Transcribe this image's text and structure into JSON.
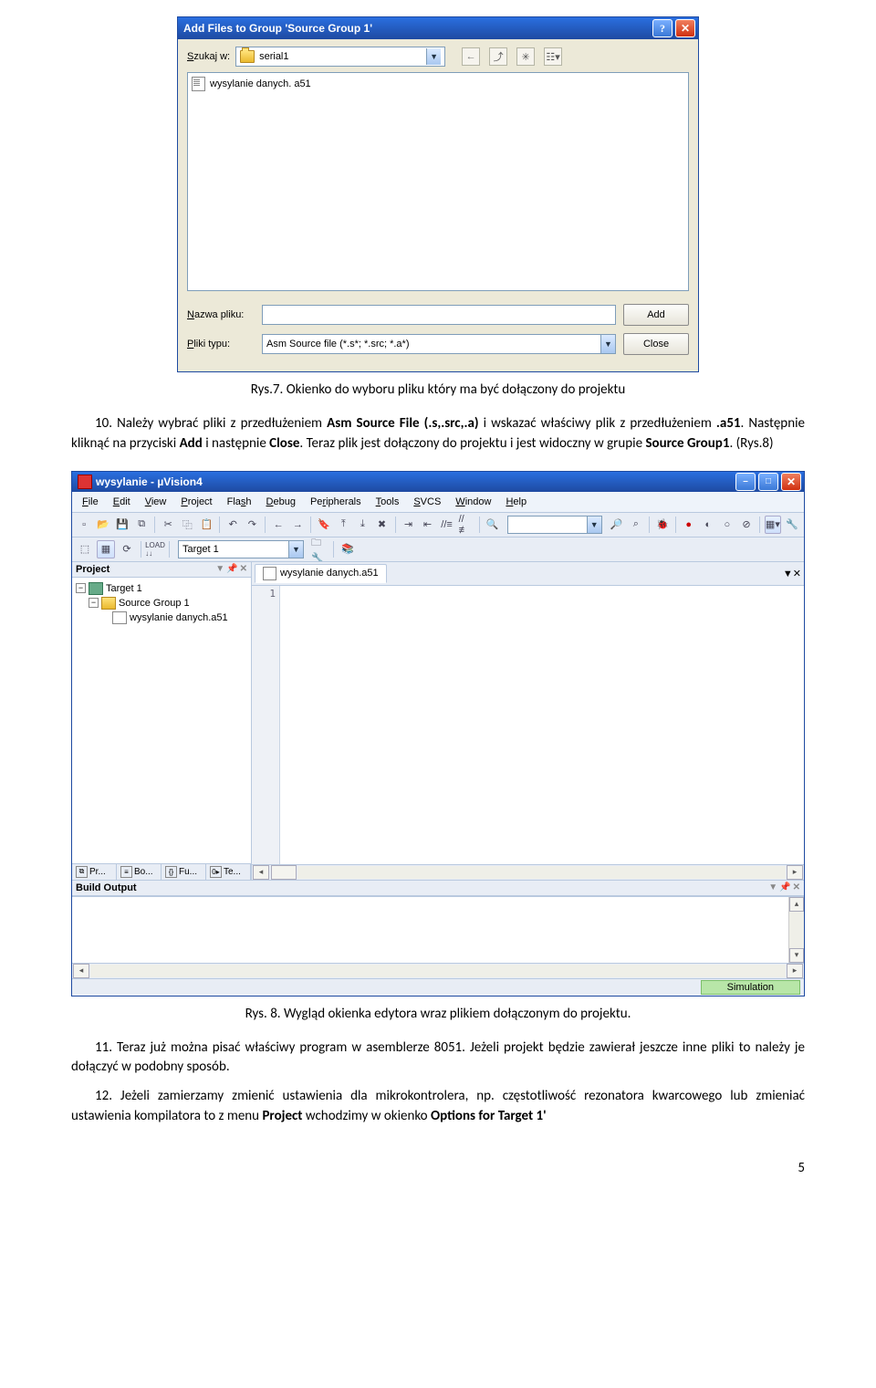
{
  "addFiles": {
    "title": "Add Files to Group 'Source Group 1'",
    "searchLabelPre": "S",
    "searchLabel": "zukaj w:",
    "folderName": "serial1",
    "fileItem": "wysylanie danych. a51",
    "filenameLabelPre": "N",
    "filenameLabel": "azwa pliku:",
    "filenameValue": "",
    "filetypeLabelPre": "P",
    "filetypeLabel": "liki typu:",
    "filetypeValue": "Asm Source file (*.s*; *.src; *.a*)",
    "addBtn": "Add",
    "closeBtn": "Close"
  },
  "caption1": "Rys.7. Okienko do wyboru pliku który ma być dołączony do projektu",
  "para10_pre": "10.",
  "para10": " Należy wybrać pliki z przedłużeniem ",
  "para10_b1": "Asm Source File (.s,.src,.a)",
  "para10_mid": " i wskazać właściwy plik z przedłużeniem ",
  "para10_b2": ".a51",
  "para10_mid2": ". Następnie kliknąć na przyciski ",
  "para10_b3": "Add",
  "para10_mid3": " i następnie ",
  "para10_b4": "Close",
  "para10_mid4": ". Teraz plik jest dołączony do projektu i jest widoczny w grupie ",
  "para10_b5": "Source Group1",
  "para10_end": ". (Rys.8)",
  "ide": {
    "title": "wysylanie  - µVision4",
    "menus": [
      {
        "u": "F",
        "r": "ile"
      },
      {
        "u": "E",
        "r": "dit"
      },
      {
        "u": "V",
        "r": "iew"
      },
      {
        "u": "P",
        "r": "roject"
      },
      {
        "u": "",
        "r": "Fla",
        "u2": "s",
        "r2": "h"
      },
      {
        "u": "D",
        "r": "ebug"
      },
      {
        "u": "",
        "r": "Pe",
        "u2": "r",
        "r2": "ipherals"
      },
      {
        "u": "T",
        "r": "ools"
      },
      {
        "u": "S",
        "r": "VCS"
      },
      {
        "u": "W",
        "r": "indow"
      },
      {
        "u": "H",
        "r": "elp"
      }
    ],
    "targetCombo": "Target 1",
    "projectPanel": {
      "title": "Project",
      "tree": {
        "root": "Target 1",
        "group": "Source Group 1",
        "file": "wysylanie danych.a51"
      },
      "tabs": [
        {
          "ico": "⧉",
          "t": "Pr..."
        },
        {
          "ico": "≡",
          "t": "Bo..."
        },
        {
          "ico": "{}",
          "t": "Fu..."
        },
        {
          "ico": "0▸",
          "t": "Te..."
        }
      ]
    },
    "editorTab": "wysylanie danych.a51",
    "gutterLine": "1",
    "buildTitle": "Build Output",
    "status": "Simulation"
  },
  "caption2": "Rys. 8. Wygląd okienka edytora wraz plikiem dołączonym do projektu.",
  "para11_pre": "11.",
  "para11": " Teraz już można pisać właściwy program w asemblerze 8051. Jeżeli projekt będzie zawierał jeszcze inne pliki to należy je dołączyć w podobny sposób.",
  "para12_pre": "12.",
  "para12_a": " Jeżeli zamierzamy zmienić ustawienia dla mikrokontrolera, np. częstotliwość rezonatora kwarcowego lub zmieniać ustawienia kompilatora to z menu ",
  "para12_b1": "Project",
  "para12_b": " wchodzimy w okienko ",
  "para12_b2": "Options for Target 1'",
  "pageNum": "5"
}
